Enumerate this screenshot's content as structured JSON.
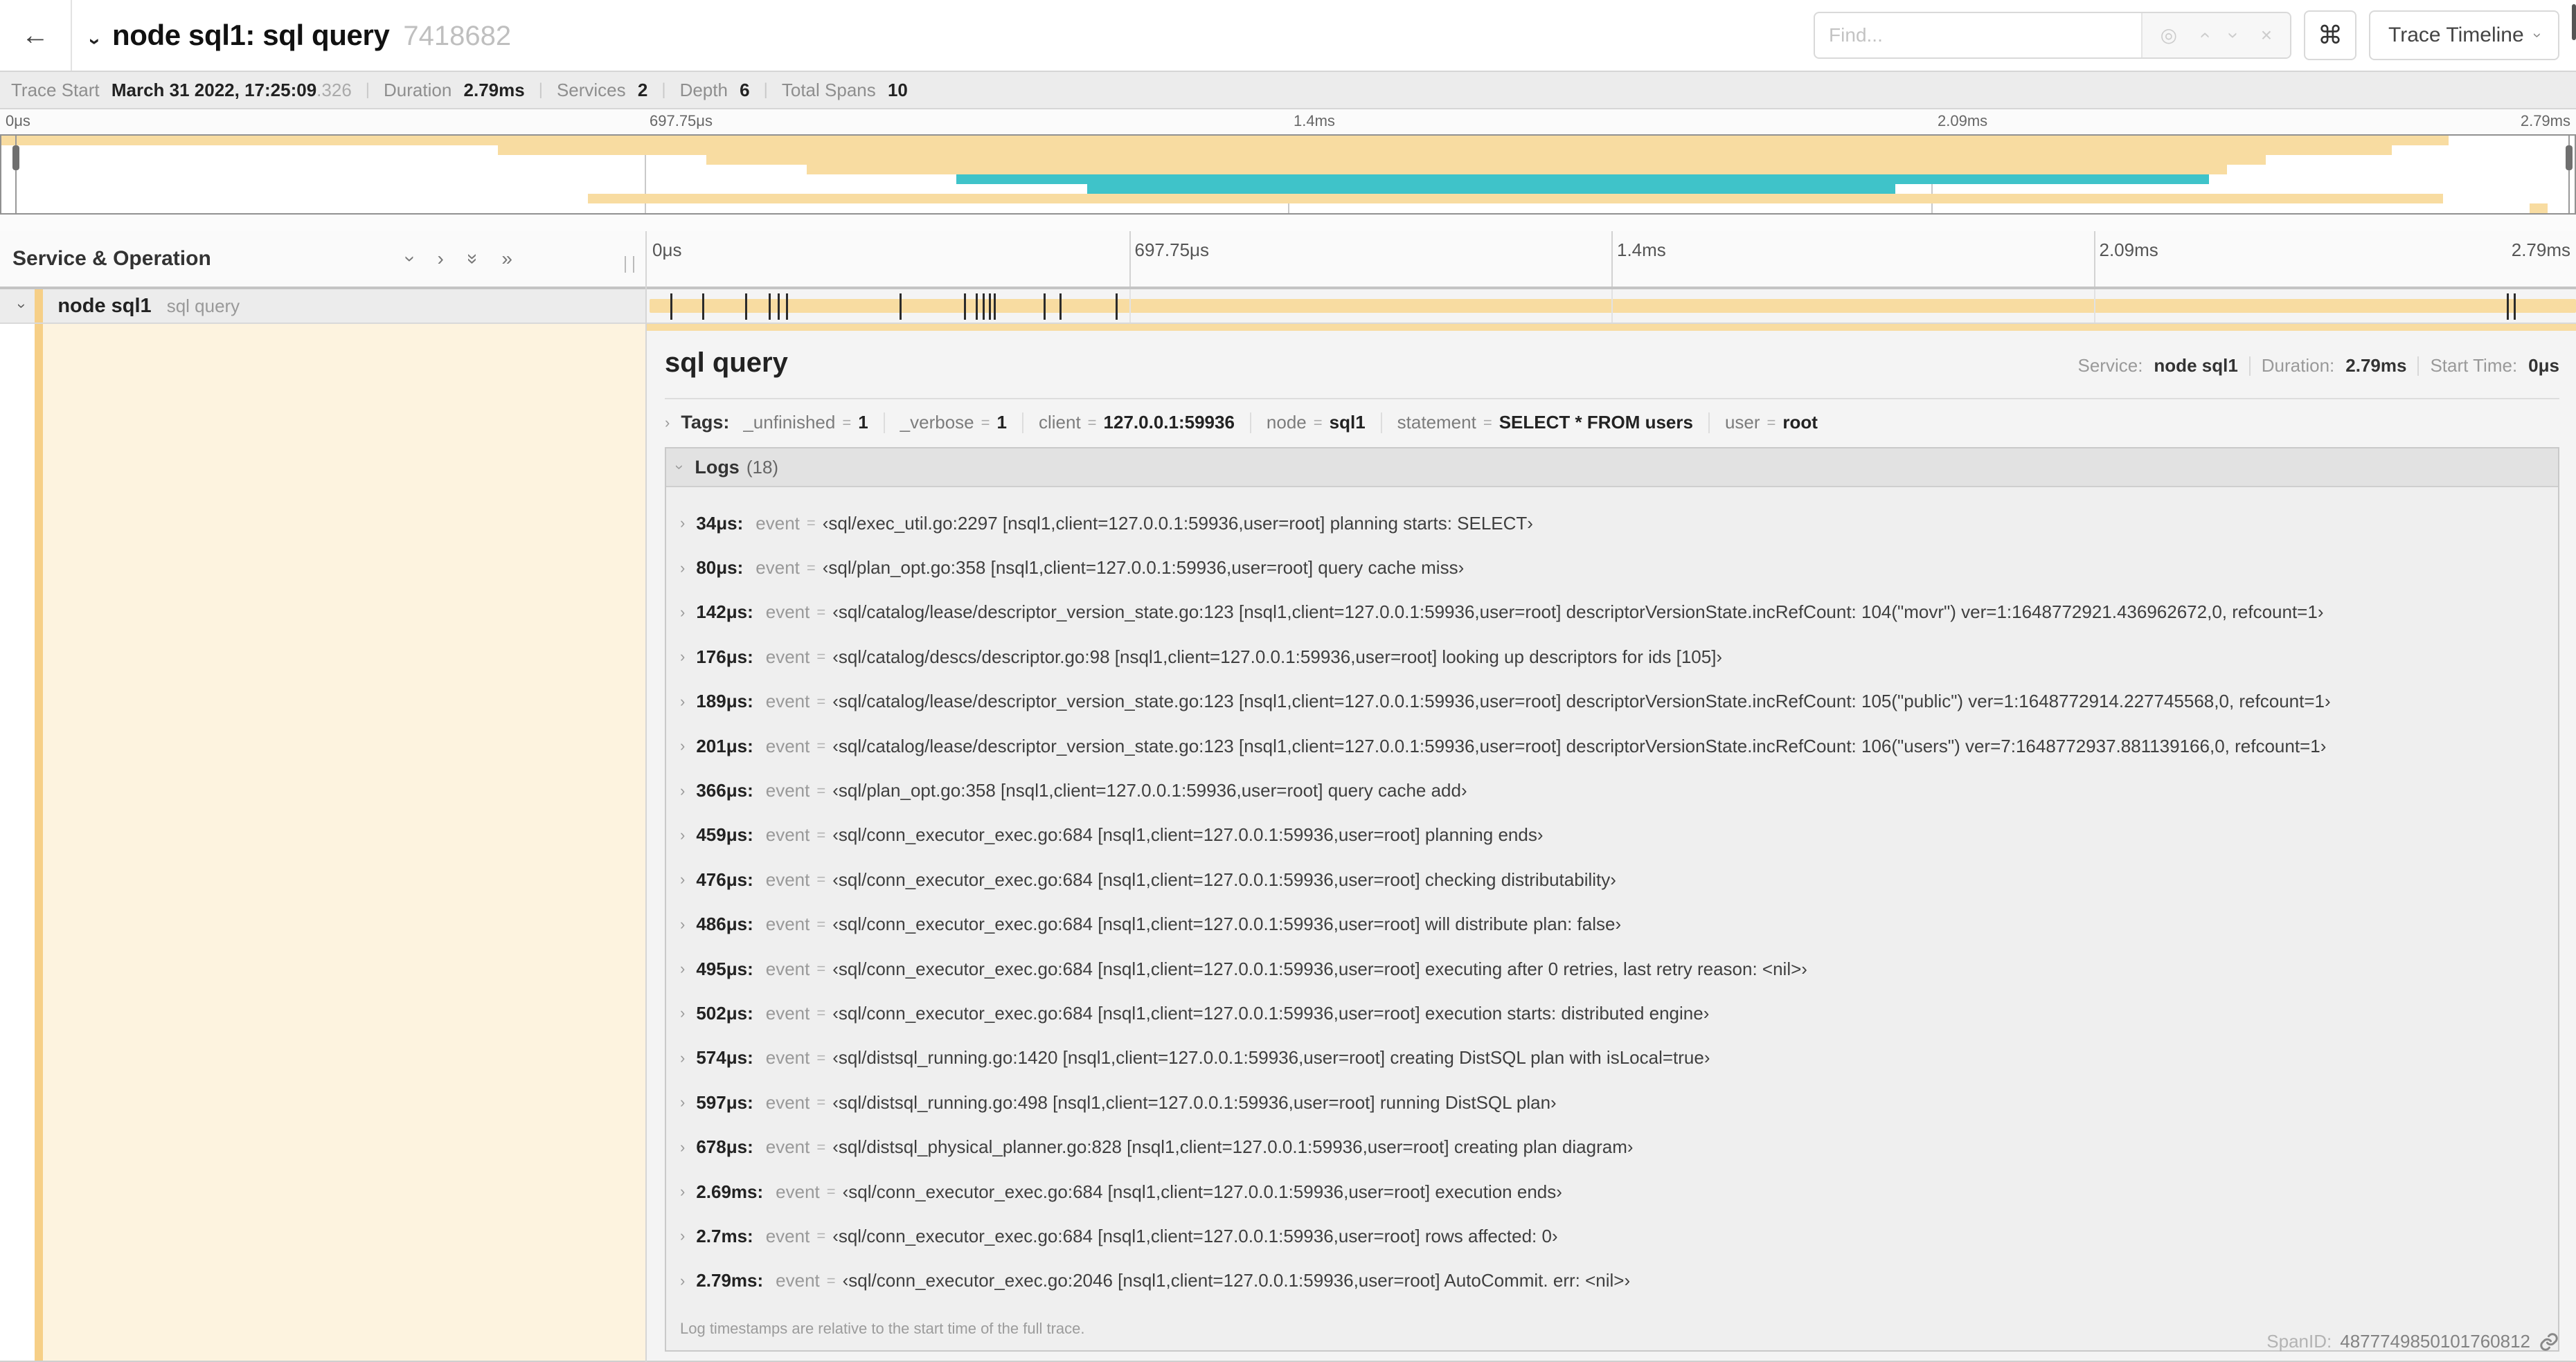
{
  "header": {
    "back_arrow": "←",
    "title": "node sql1: sql query",
    "trace_id": "7418682",
    "find_placeholder": "Find...",
    "find_tools": [
      "locate-icon",
      "prev-icon",
      "next-icon",
      "clear-icon"
    ],
    "shortcut_key": "⌘",
    "view_selector": "Trace Timeline"
  },
  "meta": {
    "items": [
      {
        "label": "Trace Start",
        "value": "March 31 2022, 17:25:09",
        "suffix": ".326"
      },
      {
        "label": "Duration",
        "value": "2.79ms"
      },
      {
        "label": "Services",
        "value": "2"
      },
      {
        "label": "Depth",
        "value": "6"
      },
      {
        "label": "Total Spans",
        "value": "10"
      }
    ]
  },
  "timeline": {
    "ticks": [
      "0μs",
      "697.75μs",
      "1.4ms",
      "2.09ms",
      "2.79ms"
    ],
    "tick_percents": [
      0,
      25,
      50,
      75,
      100
    ],
    "duration_us": 2790,
    "log_marks_us": [
      34,
      80,
      142,
      176,
      189,
      201,
      366,
      459,
      476,
      486,
      495,
      502,
      574,
      597,
      678,
      2690,
      2700,
      2790
    ],
    "minimap_spans": [
      {
        "row": 0,
        "start": 0,
        "end": 95.1,
        "color": "tan"
      },
      {
        "row": 1,
        "start": 19.3,
        "end": 92.9,
        "color": "tan"
      },
      {
        "row": 2,
        "start": 27.4,
        "end": 88.0,
        "color": "tan"
      },
      {
        "row": 3,
        "start": 31.3,
        "end": 86.5,
        "color": "tan"
      },
      {
        "row": 4,
        "start": 37.1,
        "end": 85.8,
        "color": "teal"
      },
      {
        "row": 5,
        "start": 42.2,
        "end": 73.6,
        "color": "teal"
      },
      {
        "row": 6,
        "start": 22.8,
        "end": 94.9,
        "color": "tan"
      },
      {
        "row": 7,
        "start": 98.25,
        "end": 98.95,
        "color": "tan"
      }
    ]
  },
  "tree": {
    "header": "Service & Operation",
    "row": {
      "service": "node sql1",
      "operation": "sql query"
    }
  },
  "detail": {
    "title": "sql query",
    "service_label": "Service:",
    "service": "node sql1",
    "duration_label": "Duration:",
    "duration": "2.79ms",
    "start_label": "Start Time:",
    "start": "0μs",
    "tags_label": "Tags:",
    "tags": [
      {
        "k": "_unfinished",
        "v": "1"
      },
      {
        "k": "_verbose",
        "v": "1"
      },
      {
        "k": "client",
        "v": "127.0.0.1:59936"
      },
      {
        "k": "node",
        "v": "sql1"
      },
      {
        "k": "statement",
        "v": "SELECT * FROM users"
      },
      {
        "k": "user",
        "v": "root"
      }
    ],
    "logs_label": "Logs",
    "logs_count": "(18)",
    "event_label": "event",
    "logs": [
      {
        "ts": "34μs:",
        "event": "‹sql/exec_util.go:2297 [nsql1,client=127.0.0.1:59936,user=root] planning starts: SELECT›"
      },
      {
        "ts": "80μs:",
        "event": "‹sql/plan_opt.go:358 [nsql1,client=127.0.0.1:59936,user=root] query cache miss›"
      },
      {
        "ts": "142μs:",
        "event": "‹sql/catalog/lease/descriptor_version_state.go:123 [nsql1,client=127.0.0.1:59936,user=root] descriptorVersionState.incRefCount: 104(\"movr\") ver=1:1648772921.436962672,0, refcount=1›"
      },
      {
        "ts": "176μs:",
        "event": "‹sql/catalog/descs/descriptor.go:98 [nsql1,client=127.0.0.1:59936,user=root] looking up descriptors for ids [105]›"
      },
      {
        "ts": "189μs:",
        "event": "‹sql/catalog/lease/descriptor_version_state.go:123 [nsql1,client=127.0.0.1:59936,user=root] descriptorVersionState.incRefCount: 105(\"public\") ver=1:1648772914.227745568,0, refcount=1›"
      },
      {
        "ts": "201μs:",
        "event": "‹sql/catalog/lease/descriptor_version_state.go:123 [nsql1,client=127.0.0.1:59936,user=root] descriptorVersionState.incRefCount: 106(\"users\") ver=7:1648772937.881139166,0, refcount=1›"
      },
      {
        "ts": "366μs:",
        "event": "‹sql/plan_opt.go:358 [nsql1,client=127.0.0.1:59936,user=root] query cache add›"
      },
      {
        "ts": "459μs:",
        "event": "‹sql/conn_executor_exec.go:684 [nsql1,client=127.0.0.1:59936,user=root] planning ends›"
      },
      {
        "ts": "476μs:",
        "event": "‹sql/conn_executor_exec.go:684 [nsql1,client=127.0.0.1:59936,user=root] checking distributability›"
      },
      {
        "ts": "486μs:",
        "event": "‹sql/conn_executor_exec.go:684 [nsql1,client=127.0.0.1:59936,user=root] will distribute plan: false›"
      },
      {
        "ts": "495μs:",
        "event": "‹sql/conn_executor_exec.go:684 [nsql1,client=127.0.0.1:59936,user=root] executing after 0 retries, last retry reason: <nil>›"
      },
      {
        "ts": "502μs:",
        "event": "‹sql/conn_executor_exec.go:684 [nsql1,client=127.0.0.1:59936,user=root] execution starts: distributed engine›"
      },
      {
        "ts": "574μs:",
        "event": "‹sql/distsql_running.go:1420 [nsql1,client=127.0.0.1:59936,user=root] creating DistSQL plan with isLocal=true›"
      },
      {
        "ts": "597μs:",
        "event": "‹sql/distsql_running.go:498 [nsql1,client=127.0.0.1:59936,user=root] running DistSQL plan›"
      },
      {
        "ts": "678μs:",
        "event": "‹sql/distsql_physical_planner.go:828 [nsql1,client=127.0.0.1:59936,user=root] creating plan diagram›"
      },
      {
        "ts": "2.69ms:",
        "event": "‹sql/conn_executor_exec.go:684 [nsql1,client=127.0.0.1:59936,user=root] execution ends›"
      },
      {
        "ts": "2.7ms:",
        "event": "‹sql/conn_executor_exec.go:684 [nsql1,client=127.0.0.1:59936,user=root] rows affected: 0›"
      },
      {
        "ts": "2.79ms:",
        "event": "‹sql/conn_executor_exec.go:2046 [nsql1,client=127.0.0.1:59936,user=root] AutoCommit. err: <nil>›"
      }
    ],
    "logs_note": "Log timestamps are relative to the start time of the full trace.",
    "span_id_label": "SpanID:",
    "span_id": "4877749850101760812"
  },
  "colors": {
    "tan": "#F8DCA1",
    "strip": "#F6CF87",
    "teal": "#3FC3C9",
    "cream": "#FDF3DF"
  }
}
